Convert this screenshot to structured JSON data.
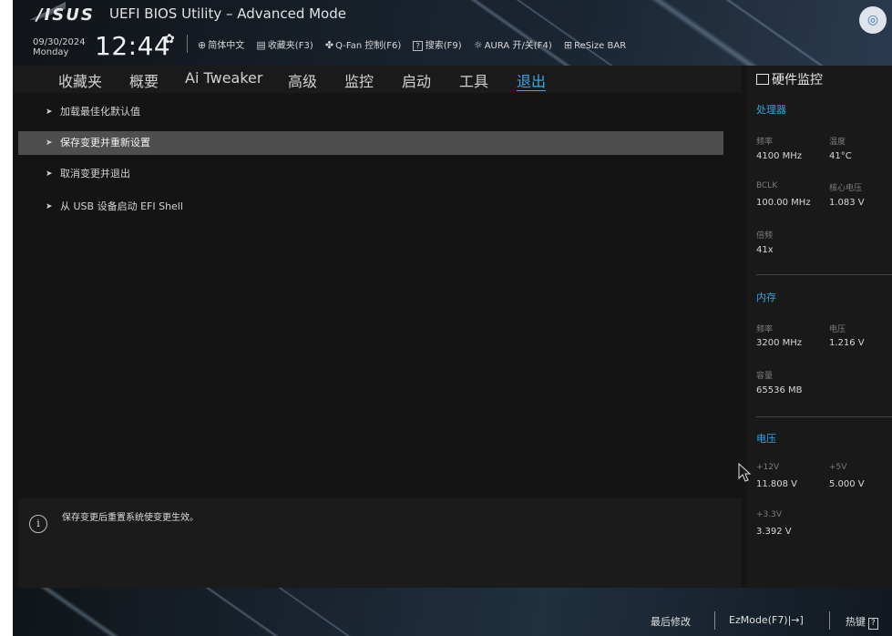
{
  "header": {
    "brand": "/ISUS",
    "title": "UEFI BIOS Utility – Advanced Mode",
    "date": "09/30/2024",
    "weekday": "Monday",
    "time": "12:44",
    "toolbar": [
      {
        "icon": "globe-icon",
        "label": "简体中文"
      },
      {
        "icon": "favorites-icon",
        "label": "收藏夹(F3)"
      },
      {
        "icon": "fan-icon",
        "label": "Q-Fan 控制(F6)"
      },
      {
        "icon": "help-box-icon",
        "label": "搜索(F9)"
      },
      {
        "icon": "aura-icon",
        "label": "AURA 开/关(F4)"
      },
      {
        "icon": "resize-bar-icon",
        "label": "ReSize BAR"
      }
    ]
  },
  "nav": {
    "tabs": [
      "收藏夹",
      "概要",
      "Ai Tweaker",
      "高级",
      "监控",
      "启动",
      "工具",
      "退出"
    ],
    "active_index": 7
  },
  "menu": {
    "items": [
      "加载最佳化默认值",
      "保存变更并重新设置",
      "取消变更并退出",
      "从 USB 设备启动 EFI Shell"
    ],
    "selected_index": 1
  },
  "help": {
    "text": "保存变更后重置系统使变更生效。"
  },
  "hw_monitor": {
    "title": "硬件监控",
    "cpu": {
      "heading": "处理器",
      "freq_label": "频率",
      "freq": "4100 MHz",
      "temp_label": "温度",
      "temp": "41°C",
      "bclk_label": "BCLK",
      "bclk": "100.00 MHz",
      "vcore_label": "核心电压",
      "vcore": "1.083 V",
      "ratio_label": "倍频",
      "ratio": "41x"
    },
    "memory": {
      "heading": "内存",
      "freq_label": "频率",
      "freq": "3200 MHz",
      "volt_label": "电压",
      "volt": "1.216 V",
      "cap_label": "容量",
      "cap": "65536 MB"
    },
    "voltage": {
      "heading": "电压",
      "v12_label": "+12V",
      "v12": "11.808 V",
      "v5_label": "+5V",
      "v5": "5.000 V",
      "v33_label": "+3.3V",
      "v33": "3.392 V"
    }
  },
  "footer": {
    "last_modified": "最后修改",
    "ezmode": "EzMode(F7)|→]",
    "hotkeys": "热键"
  },
  "colors": {
    "accent": "#34a5e0",
    "selected_row": "#4e4e4e",
    "background": "#141414"
  }
}
